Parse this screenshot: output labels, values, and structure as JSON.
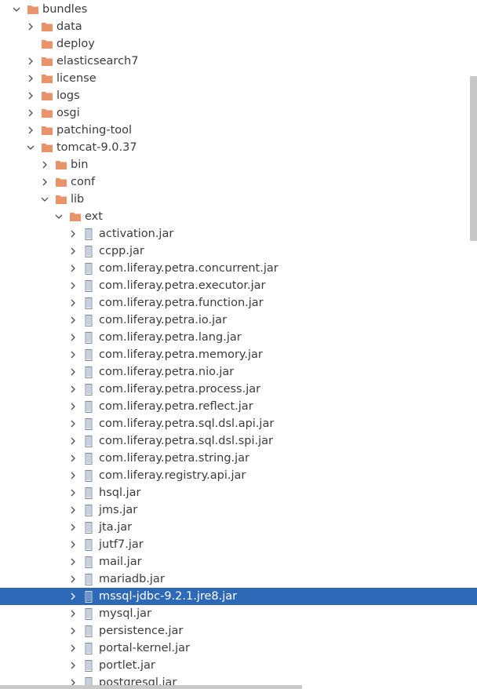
{
  "colors": {
    "folder": "#e8936a",
    "jar": "#7b8aa5",
    "selection": "#2d69b6"
  },
  "tree": [
    {
      "label": "bundles",
      "type": "folder",
      "depth": 0,
      "state": "open"
    },
    {
      "label": "data",
      "type": "folder",
      "depth": 1,
      "state": "closed"
    },
    {
      "label": "deploy",
      "type": "folder",
      "depth": 1,
      "state": "none"
    },
    {
      "label": "elasticsearch7",
      "type": "folder",
      "depth": 1,
      "state": "closed"
    },
    {
      "label": "license",
      "type": "folder",
      "depth": 1,
      "state": "closed"
    },
    {
      "label": "logs",
      "type": "folder",
      "depth": 1,
      "state": "closed"
    },
    {
      "label": "osgi",
      "type": "folder",
      "depth": 1,
      "state": "closed"
    },
    {
      "label": "patching-tool",
      "type": "folder",
      "depth": 1,
      "state": "closed"
    },
    {
      "label": "tomcat-9.0.37",
      "type": "folder",
      "depth": 1,
      "state": "open"
    },
    {
      "label": "bin",
      "type": "folder",
      "depth": 2,
      "state": "closed"
    },
    {
      "label": "conf",
      "type": "folder",
      "depth": 2,
      "state": "closed"
    },
    {
      "label": "lib",
      "type": "folder",
      "depth": 2,
      "state": "open"
    },
    {
      "label": "ext",
      "type": "folder",
      "depth": 3,
      "state": "open"
    },
    {
      "label": "activation.jar",
      "type": "jar",
      "depth": 4,
      "state": "closed"
    },
    {
      "label": "ccpp.jar",
      "type": "jar",
      "depth": 4,
      "state": "closed"
    },
    {
      "label": "com.liferay.petra.concurrent.jar",
      "type": "jar",
      "depth": 4,
      "state": "closed"
    },
    {
      "label": "com.liferay.petra.executor.jar",
      "type": "jar",
      "depth": 4,
      "state": "closed"
    },
    {
      "label": "com.liferay.petra.function.jar",
      "type": "jar",
      "depth": 4,
      "state": "closed"
    },
    {
      "label": "com.liferay.petra.io.jar",
      "type": "jar",
      "depth": 4,
      "state": "closed"
    },
    {
      "label": "com.liferay.petra.lang.jar",
      "type": "jar",
      "depth": 4,
      "state": "closed"
    },
    {
      "label": "com.liferay.petra.memory.jar",
      "type": "jar",
      "depth": 4,
      "state": "closed"
    },
    {
      "label": "com.liferay.petra.nio.jar",
      "type": "jar",
      "depth": 4,
      "state": "closed"
    },
    {
      "label": "com.liferay.petra.process.jar",
      "type": "jar",
      "depth": 4,
      "state": "closed"
    },
    {
      "label": "com.liferay.petra.reflect.jar",
      "type": "jar",
      "depth": 4,
      "state": "closed"
    },
    {
      "label": "com.liferay.petra.sql.dsl.api.jar",
      "type": "jar",
      "depth": 4,
      "state": "closed"
    },
    {
      "label": "com.liferay.petra.sql.dsl.spi.jar",
      "type": "jar",
      "depth": 4,
      "state": "closed"
    },
    {
      "label": "com.liferay.petra.string.jar",
      "type": "jar",
      "depth": 4,
      "state": "closed"
    },
    {
      "label": "com.liferay.registry.api.jar",
      "type": "jar",
      "depth": 4,
      "state": "closed"
    },
    {
      "label": "hsql.jar",
      "type": "jar",
      "depth": 4,
      "state": "closed"
    },
    {
      "label": "jms.jar",
      "type": "jar",
      "depth": 4,
      "state": "closed"
    },
    {
      "label": "jta.jar",
      "type": "jar",
      "depth": 4,
      "state": "closed"
    },
    {
      "label": "jutf7.jar",
      "type": "jar",
      "depth": 4,
      "state": "closed"
    },
    {
      "label": "mail.jar",
      "type": "jar",
      "depth": 4,
      "state": "closed"
    },
    {
      "label": "mariadb.jar",
      "type": "jar",
      "depth": 4,
      "state": "closed"
    },
    {
      "label": "mssql-jdbc-9.2.1.jre8.jar",
      "type": "jar",
      "depth": 4,
      "state": "closed",
      "selected": true
    },
    {
      "label": "mysql.jar",
      "type": "jar",
      "depth": 4,
      "state": "closed"
    },
    {
      "label": "persistence.jar",
      "type": "jar",
      "depth": 4,
      "state": "closed"
    },
    {
      "label": "portal-kernel.jar",
      "type": "jar",
      "depth": 4,
      "state": "closed"
    },
    {
      "label": "portlet.jar",
      "type": "jar",
      "depth": 4,
      "state": "closed"
    },
    {
      "label": "postgresql.jar",
      "type": "jar",
      "depth": 4,
      "state": "closed"
    }
  ]
}
